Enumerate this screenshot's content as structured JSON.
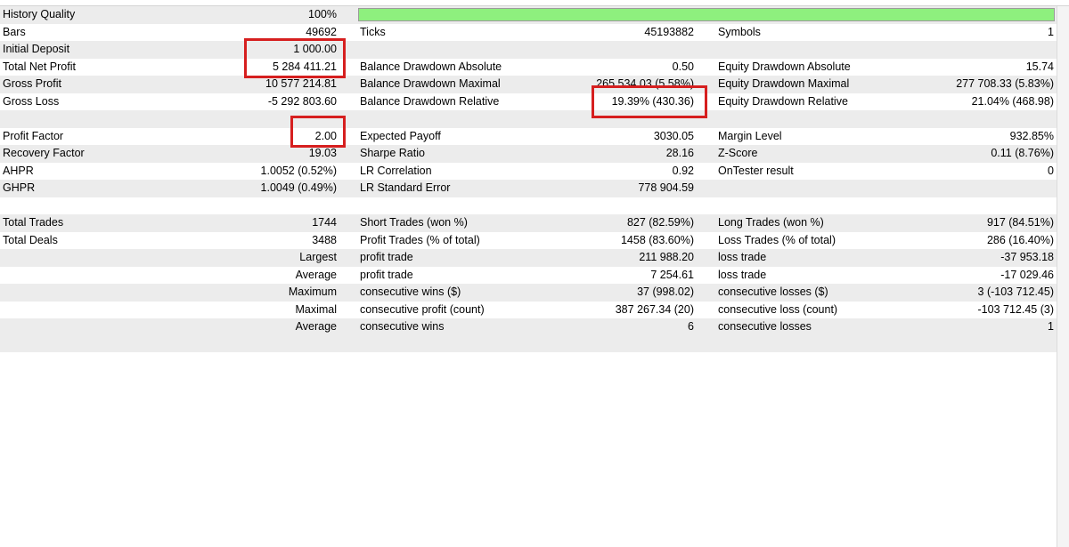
{
  "history_quality": {
    "label": "History Quality",
    "value": "100%",
    "fill_fraction": 1.0
  },
  "rows": [
    {
      "name": "bars-row",
      "c1": "Bars",
      "c2": "49692",
      "c3": "Ticks",
      "c4": "45193882",
      "c5": "Symbols",
      "c6": "1"
    },
    {
      "name": "initial-deposit-row",
      "c1": "Initial Deposit",
      "c2": "1 000.00",
      "c3": "",
      "c4": "",
      "c5": "",
      "c6": ""
    },
    {
      "name": "total-net-profit-row",
      "c1": "Total Net Profit",
      "c2": "5 284 411.21",
      "c3": "Balance Drawdown Absolute",
      "c4": "0.50",
      "c5": "Equity Drawdown Absolute",
      "c6": "15.74"
    },
    {
      "name": "gross-profit-row",
      "c1": "Gross Profit",
      "c2": "10 577 214.81",
      "c3": "Balance Drawdown Maximal",
      "c4": "265 534.03 (5.58%)",
      "c5": "Equity Drawdown Maximal",
      "c6": "277 708.33 (5.83%)"
    },
    {
      "name": "gross-loss-row",
      "c1": "Gross Loss",
      "c2": "-5 292 803.60",
      "c3": "Balance Drawdown Relative",
      "c4": "19.39% (430.36)",
      "c5": "Equity Drawdown Relative",
      "c6": "21.04% (468.98)"
    },
    {
      "name": "spacer-row-1",
      "c1": "",
      "c2": "",
      "c3": "",
      "c4": "",
      "c5": "",
      "c6": ""
    },
    {
      "name": "profit-factor-row",
      "c1": "Profit Factor",
      "c2": "2.00",
      "c3": "Expected Payoff",
      "c4": "3030.05",
      "c5": "Margin Level",
      "c6": "932.85%"
    },
    {
      "name": "recovery-factor-row",
      "c1": "Recovery Factor",
      "c2": "19.03",
      "c3": "Sharpe Ratio",
      "c4": "28.16",
      "c5": "Z-Score",
      "c6": "0.11 (8.76%)"
    },
    {
      "name": "ahpr-row",
      "c1": "AHPR",
      "c2": "1.0052 (0.52%)",
      "c3": "LR Correlation",
      "c4": "0.92",
      "c5": "OnTester result",
      "c6": "0"
    },
    {
      "name": "ghpr-row",
      "c1": "GHPR",
      "c2": "1.0049 (0.49%)",
      "c3": "LR Standard Error",
      "c4": "778 904.59",
      "c5": "",
      "c6": ""
    },
    {
      "name": "spacer-row-2",
      "c1": "",
      "c2": "",
      "c3": "",
      "c4": "",
      "c5": "",
      "c6": ""
    },
    {
      "name": "total-trades-row",
      "c1": "Total Trades",
      "c2": "1744",
      "c3": "Short Trades (won %)",
      "c4": "827 (82.59%)",
      "c5": "Long Trades (won %)",
      "c6": "917 (84.51%)"
    },
    {
      "name": "total-deals-row",
      "c1": "Total Deals",
      "c2": "3488",
      "c3": "Profit Trades (% of total)",
      "c4": "1458 (83.60%)",
      "c5": "Loss Trades (% of total)",
      "c6": "286 (16.40%)"
    },
    {
      "name": "largest-row",
      "c1": "",
      "c2": "Largest",
      "c3": "profit trade",
      "c4": "211 988.20",
      "c5": "loss trade",
      "c6": "-37 953.18"
    },
    {
      "name": "average-trade-row",
      "c1": "",
      "c2": "Average",
      "c3": "profit trade",
      "c4": "7 254.61",
      "c5": "loss trade",
      "c6": "-17 029.46"
    },
    {
      "name": "maximum-consecutive-row",
      "c1": "",
      "c2": "Maximum",
      "c3": "consecutive wins ($)",
      "c4": "37 (998.02)",
      "c5": "consecutive losses ($)",
      "c6": "3 (-103 712.45)"
    },
    {
      "name": "maximal-consecutive-row",
      "c1": "",
      "c2": "Maximal",
      "c3": "consecutive profit (count)",
      "c4": "387 267.34 (20)",
      "c5": "consecutive loss (count)",
      "c6": "-103 712.45 (3)"
    },
    {
      "name": "average-consecutive-row",
      "c1": "",
      "c2": "Average",
      "c3": "consecutive wins",
      "c4": "6",
      "c5": "consecutive losses",
      "c6": "1"
    }
  ],
  "colors": {
    "quality_bar": "#8ef07e",
    "highlight": "#d61f1f",
    "alt_row": "#ececec"
  }
}
